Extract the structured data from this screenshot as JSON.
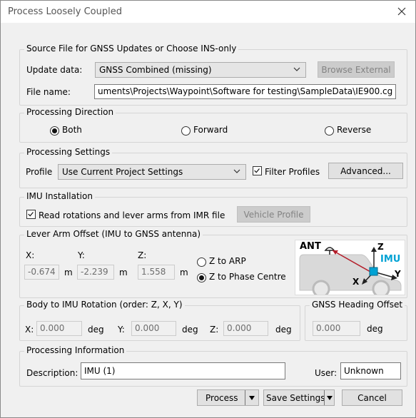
{
  "window": {
    "title": "Process Loosely Coupled"
  },
  "source": {
    "group_title": "Source File for GNSS Updates or Choose INS-only",
    "update_label": "Update data:",
    "update_value": "GNSS Combined (missing)",
    "browse_label": "Browse External",
    "file_label": "File name:",
    "file_value": "uments\\Projects\\Waypoint\\Software for testing\\SampleData\\IE900.cg"
  },
  "direction": {
    "group_title": "Processing Direction",
    "options": [
      "Both",
      "Forward",
      "Reverse"
    ],
    "selected": "Both"
  },
  "settings": {
    "group_title": "Processing Settings",
    "profile_label": "Profile",
    "profile_value": "Use Current Project Settings",
    "filter_label": "Filter Profiles",
    "filter_checked": true,
    "advanced_label": "Advanced..."
  },
  "imu_install": {
    "group_title": "IMU Installation",
    "read_label": "Read rotations and lever arms from IMR file",
    "read_checked": true,
    "vehicle_label": "Vehicle Profile"
  },
  "lever": {
    "group_title": "Lever Arm Offset (IMU to GNSS antenna)",
    "x_label": "X:",
    "y_label": "Y:",
    "z_label": "Z:",
    "x_value": "-0.674",
    "y_value": "-2.239",
    "z_value": "1.558",
    "unit": "m",
    "arp_label": "Z to ARP",
    "phase_label": "Z to Phase Centre",
    "selected": "Z to Phase Centre",
    "diagram": {
      "ant": "ANT",
      "z": "Z",
      "imu": "IMU",
      "x": "X",
      "y": "Y"
    }
  },
  "rotation": {
    "group_title": "Body to IMU Rotation (order: Z, X, Y)",
    "x_label": "X:",
    "y_label": "Y:",
    "z_label": "Z:",
    "x_value": "0.000",
    "y_value": "0.000",
    "z_value": "0.000",
    "unit": "deg"
  },
  "heading": {
    "group_title": "GNSS Heading Offset",
    "value": "0.000",
    "unit": "deg"
  },
  "info": {
    "group_title": "Processing Information",
    "desc_label": "Description:",
    "desc_value": "IMU (1)",
    "user_label": "User:",
    "user_value": "Unknown"
  },
  "footer": {
    "process_label": "Process",
    "save_label": "Save Settings",
    "cancel_label": "Cancel"
  },
  "colors": {
    "accent": "#00a2d4",
    "arrow": "#b41e2a"
  }
}
